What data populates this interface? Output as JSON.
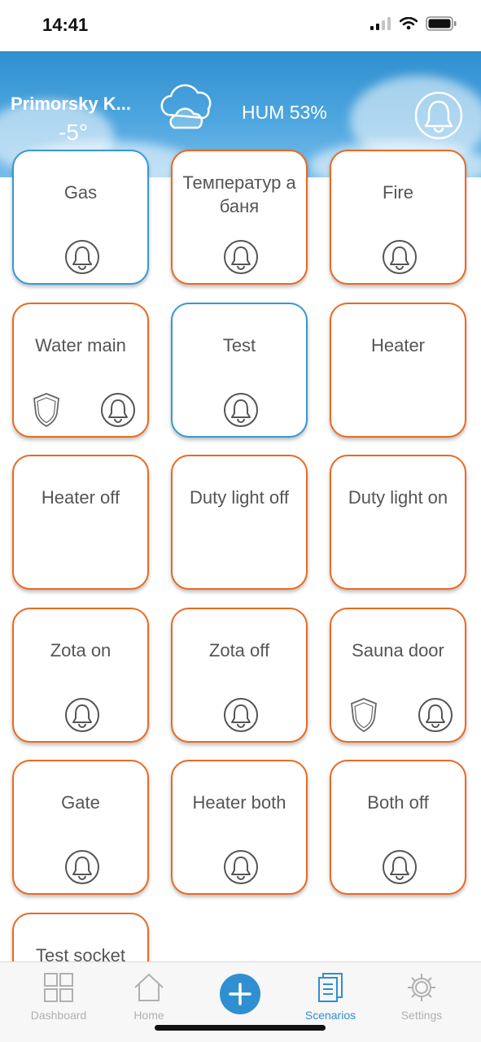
{
  "status_bar": {
    "time": "14:41"
  },
  "header": {
    "location": "Primorsky K...",
    "temperature": "-5°",
    "humidity": "HUM 53%"
  },
  "cards": [
    {
      "label": "Gas",
      "border": "blue",
      "bell": true,
      "shield": false
    },
    {
      "label": "Температур а баня",
      "border": "orange",
      "bell": true,
      "shield": false
    },
    {
      "label": "Fire",
      "border": "orange",
      "bell": true,
      "shield": false
    },
    {
      "label": "Water main",
      "border": "orange",
      "bell": true,
      "shield": true
    },
    {
      "label": "Test",
      "border": "blue",
      "bell": true,
      "shield": false
    },
    {
      "label": "Heater",
      "border": "orange",
      "bell": false,
      "shield": false
    },
    {
      "label": "Heater off",
      "border": "orange",
      "bell": false,
      "shield": false
    },
    {
      "label": "Duty light off",
      "border": "orange",
      "bell": false,
      "shield": false
    },
    {
      "label": "Duty light on",
      "border": "orange",
      "bell": false,
      "shield": false
    },
    {
      "label": "Zota on",
      "border": "orange",
      "bell": true,
      "shield": false
    },
    {
      "label": "Zota off",
      "border": "orange",
      "bell": true,
      "shield": false
    },
    {
      "label": "Sauna door",
      "border": "orange",
      "bell": true,
      "shield": true
    },
    {
      "label": "Gate",
      "border": "orange",
      "bell": true,
      "shield": false
    },
    {
      "label": "Heater both",
      "border": "orange",
      "bell": true,
      "shield": false
    },
    {
      "label": "Both off",
      "border": "orange",
      "bell": true,
      "shield": false
    },
    {
      "label": "Test socket",
      "border": "orange",
      "bell": false,
      "shield": false
    }
  ],
  "tabs": {
    "dashboard": "Dashboard",
    "home": "Home",
    "scenarios": "Scenarios",
    "settings": "Settings",
    "active": "scenarios"
  },
  "colors": {
    "accent_blue": "#2f8fd0",
    "card_orange": "#ea6a22",
    "card_blue": "#3898d4",
    "text_gray": "#555555",
    "tab_inactive": "#b0b0b0"
  },
  "icons": {
    "weather": "cloud-icon",
    "header_bell": "bell-icon",
    "card_bell": "bell-icon",
    "card_shield": "shield-icon",
    "add": "plus-icon"
  }
}
